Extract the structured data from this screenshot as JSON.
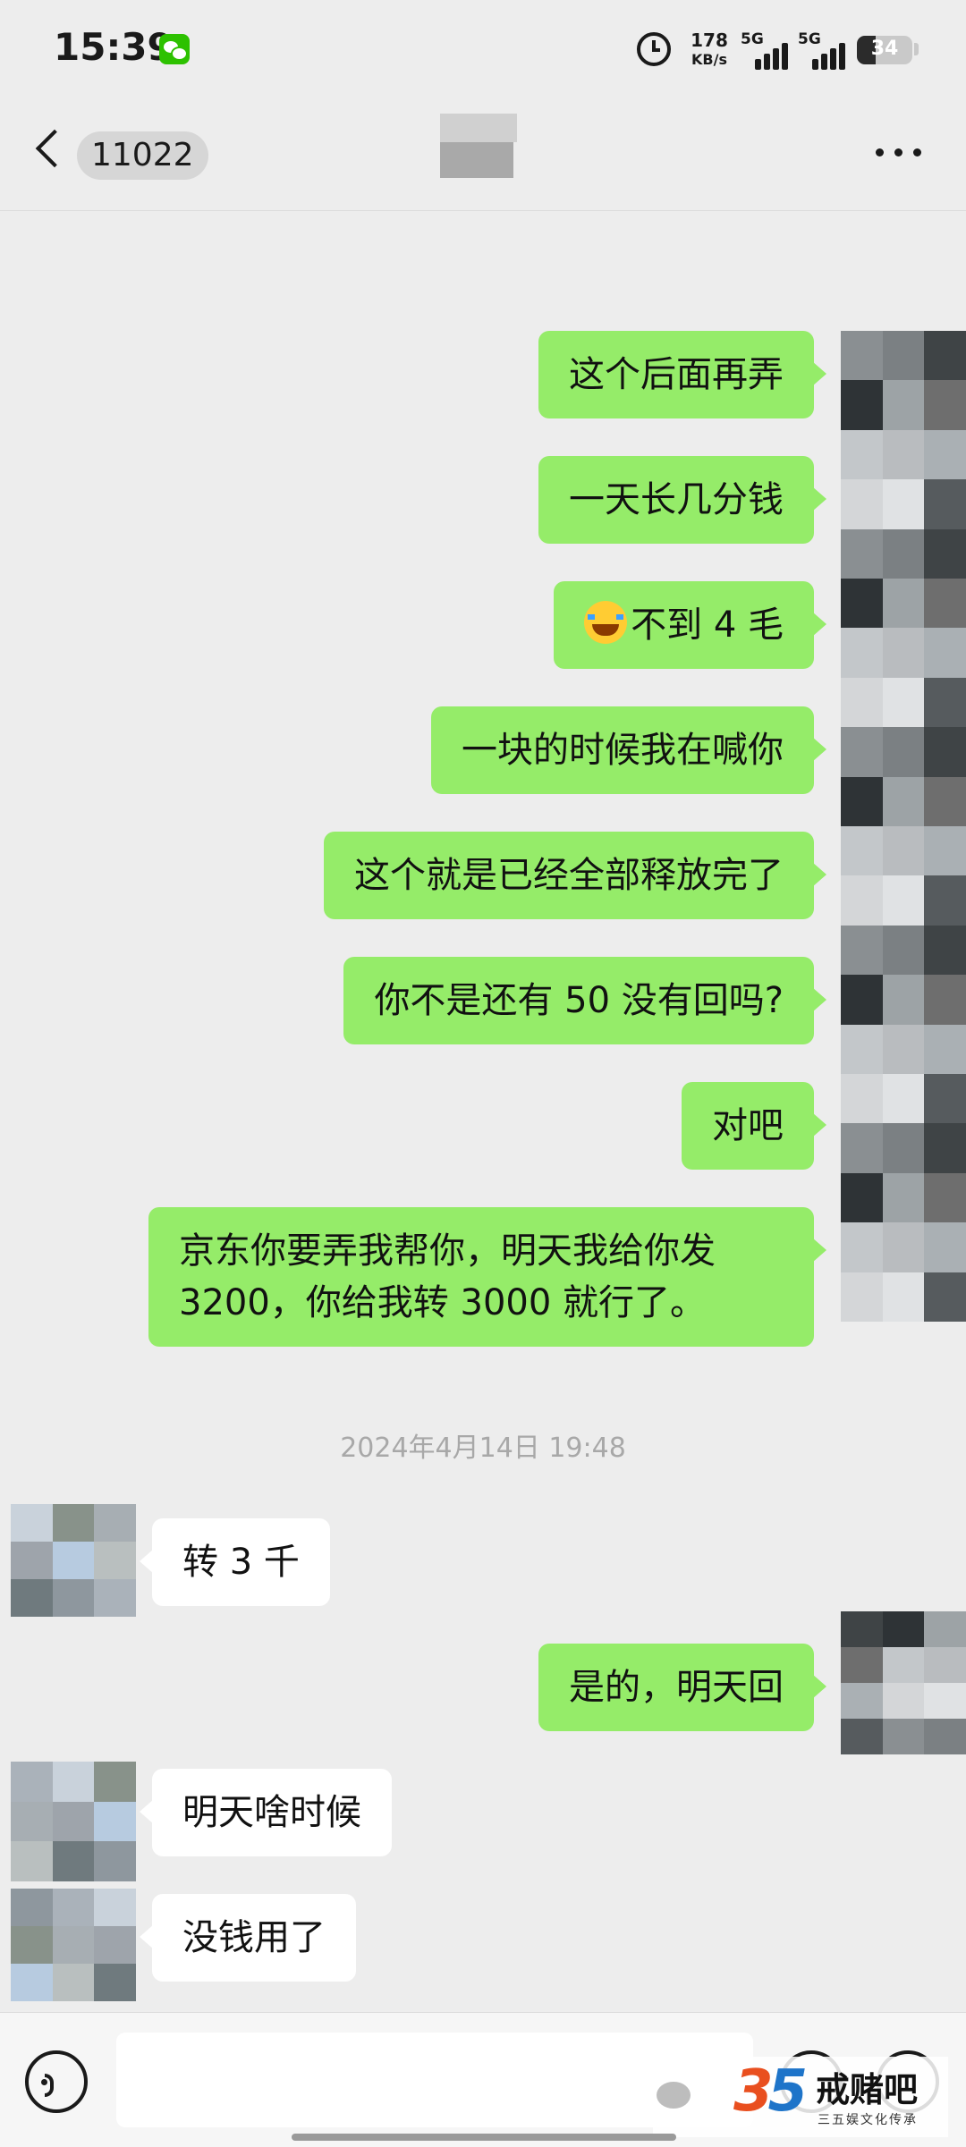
{
  "status_bar": {
    "time": "15:39",
    "net_speed": "178",
    "net_unit": "KB/s",
    "sim1": "5G",
    "sim2": "5G",
    "battery": "34",
    "battery_level": 0.34
  },
  "header": {
    "unread_count": "11022"
  },
  "messages": [
    {
      "side": "sent",
      "text": "这个后面再弄"
    },
    {
      "side": "sent",
      "text": "一天长几分钱"
    },
    {
      "side": "sent",
      "text": "不到 4 毛",
      "emoji": "laughing-tears-emoji-icon"
    },
    {
      "side": "sent",
      "text": "一块的时候我在喊你"
    },
    {
      "side": "sent",
      "text": "这个就是已经全部释放完了"
    },
    {
      "side": "sent",
      "text": "你不是还有 50 没有回吗?"
    },
    {
      "side": "sent",
      "text": "对吧"
    },
    {
      "side": "sent",
      "text": "京东你要弄我帮你，明天我给你发 3200，你给我转 3000 就行了。"
    },
    {
      "side": "timestamp",
      "text": "2024年4月14日 19:48"
    },
    {
      "side": "received",
      "text": "转 3 千"
    },
    {
      "side": "sent",
      "text": "是的，明天回"
    },
    {
      "side": "received",
      "text": "明天啥时候"
    },
    {
      "side": "received",
      "text": "没钱用了"
    }
  ],
  "watermark": {
    "logo_left": "3",
    "logo_right": "5",
    "name": "戒赌吧",
    "tagline": "三五娱文化传承"
  },
  "colors": {
    "sent_bubble": "#95ec69",
    "received_bubble": "#ffffff",
    "background": "#ededed"
  }
}
